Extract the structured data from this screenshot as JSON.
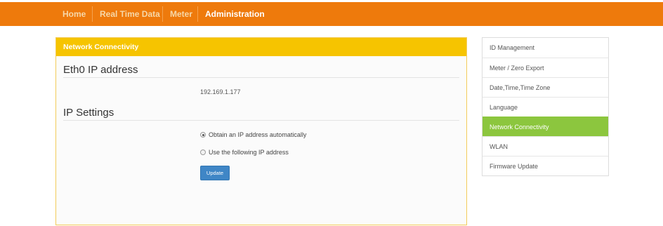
{
  "nav": {
    "items": [
      {
        "label": "Home"
      },
      {
        "label": "Real Time Data"
      },
      {
        "label": "Meter"
      },
      {
        "label": "Administration"
      }
    ],
    "active": "Administration"
  },
  "panel": {
    "header": "Network Connectivity",
    "eth0_title": "Eth0 IP address",
    "ip_address": "192.169.1.177",
    "ip_settings_title": "IP Settings",
    "options": [
      {
        "label": "Obtain an IP address automatically",
        "checked": true
      },
      {
        "label": "Use the following IP address",
        "checked": false
      }
    ],
    "update_label": "Update"
  },
  "sidebar": {
    "items": [
      {
        "label": "ID Management"
      },
      {
        "label": "Meter / Zero Export"
      },
      {
        "label": "Date,Time,Time Zone"
      },
      {
        "label": "Language"
      },
      {
        "label": "Network Connectivity"
      },
      {
        "label": "WLAN"
      },
      {
        "label": "Firmware Update"
      }
    ],
    "active": "Network Connectivity"
  },
  "colors": {
    "navbar": "#ee7a0c",
    "panel_header": "#f6c400",
    "active_sidebar": "#8cc63e",
    "button": "#3f86c6"
  }
}
